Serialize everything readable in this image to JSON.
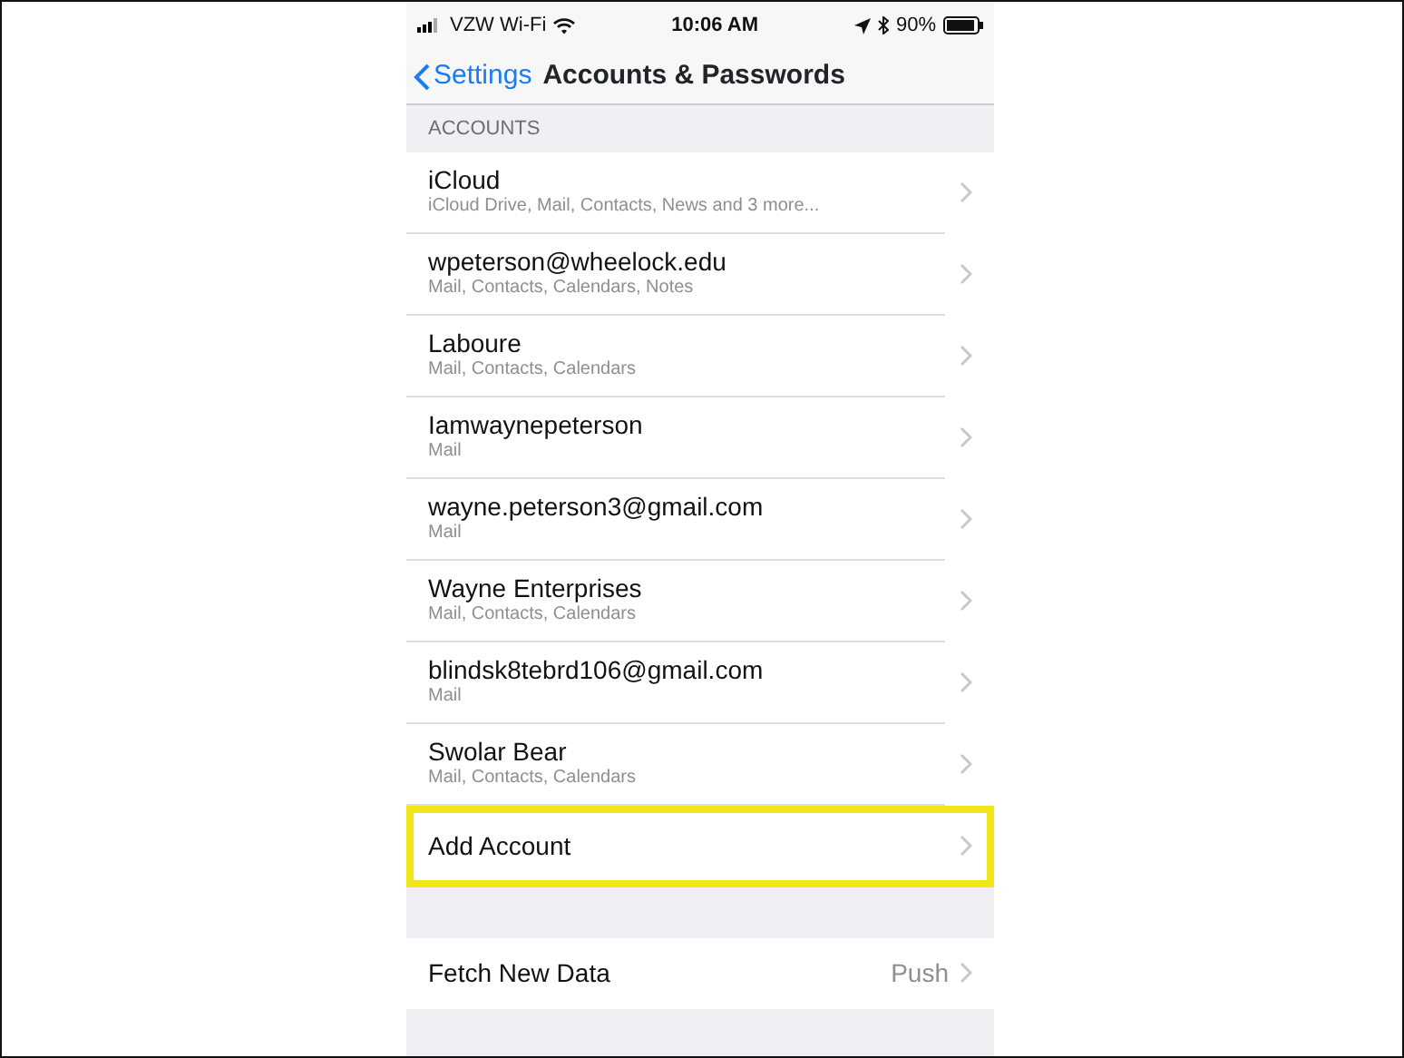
{
  "status_bar": {
    "carrier": "VZW Wi-Fi",
    "time": "10:06 AM",
    "battery": "90%"
  },
  "nav_bar": {
    "back": "Settings",
    "title": "Accounts & Passwords"
  },
  "section_header": "ACCOUNTS",
  "accounts": [
    {
      "name": "iCloud",
      "detail": "iCloud Drive, Mail, Contacts, News and 3 more..."
    },
    {
      "name": "wpeterson@wheelock.edu",
      "detail": "Mail, Contacts, Calendars, Notes"
    },
    {
      "name": "Laboure",
      "detail": "Mail, Contacts, Calendars"
    },
    {
      "name": "Iamwaynepeterson",
      "detail": "Mail"
    },
    {
      "name": "wayne.peterson3@gmail.com",
      "detail": "Mail"
    },
    {
      "name": "Wayne Enterprises",
      "detail": "Mail, Contacts, Calendars"
    },
    {
      "name": "blindsk8tebrd106@gmail.com",
      "detail": "Mail"
    },
    {
      "name": "Swolar Bear",
      "detail": "Mail, Contacts, Calendars"
    }
  ],
  "add_account": {
    "label": "Add Account",
    "highlighted": true
  },
  "fetch_row": {
    "label": "Fetch New Data",
    "value": "Push"
  }
}
